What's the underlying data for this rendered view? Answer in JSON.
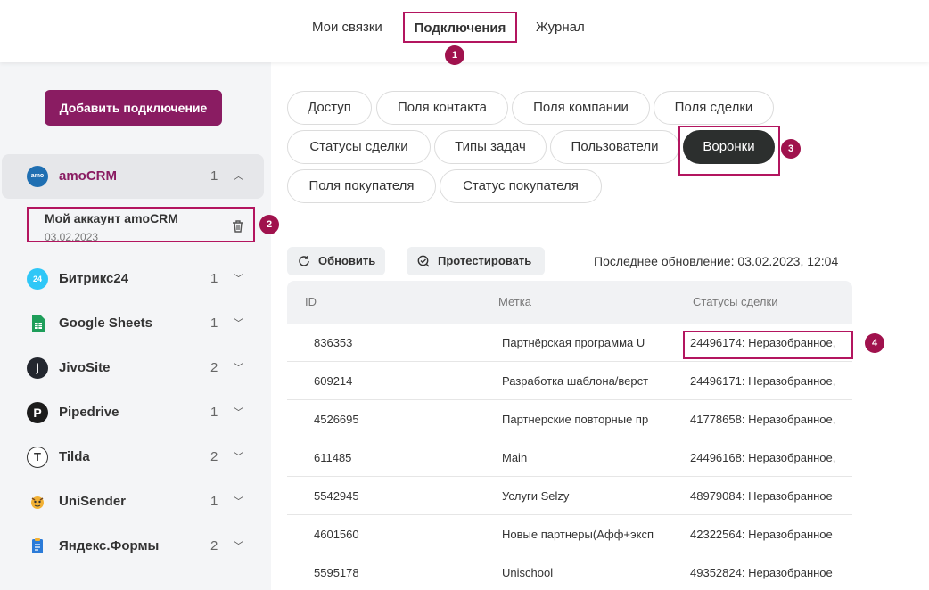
{
  "nav": {
    "tabs": [
      "Мои связки",
      "Подключения",
      "Журнал"
    ],
    "active": "Подключения"
  },
  "badges": [
    "1",
    "2",
    "3",
    "4"
  ],
  "sidebar": {
    "add_button": "Добавить подключение",
    "services": [
      {
        "name": "amoCRM",
        "count": "1",
        "logo": "amo",
        "color": "#1f6fb2",
        "icon": "amocrm-logo-icon"
      },
      {
        "name": "Битрикс24",
        "count": "1",
        "logo": "24",
        "color": "#2fc7f7",
        "icon": "bitrix24-logo-icon"
      },
      {
        "name": "Google Sheets",
        "count": "1",
        "logo": "",
        "color": "#1e9e5a",
        "icon": "google-sheets-logo-icon"
      },
      {
        "name": "JivoSite",
        "count": "2",
        "logo": "j",
        "color": "#23272f",
        "icon": "jivosite-logo-icon"
      },
      {
        "name": "Pipedrive",
        "count": "1",
        "logo": "P",
        "color": "#1c1c1c",
        "icon": "pipedrive-logo-icon"
      },
      {
        "name": "Tilda",
        "count": "2",
        "logo": "T",
        "color": "#ffffff",
        "icon": "tilda-logo-icon"
      },
      {
        "name": "UniSender",
        "count": "1",
        "logo": "",
        "color": "#f2b134",
        "icon": "unisender-logo-icon"
      },
      {
        "name": "Яндекс.Формы",
        "count": "2",
        "logo": "",
        "color": "#2b7bd8",
        "icon": "yandex-forms-logo-icon"
      }
    ],
    "account": {
      "name": "Мой аккаунт amoCRM",
      "date": "03.02.2023"
    }
  },
  "chips": [
    "Доступ",
    "Поля контакта",
    "Поля компании",
    "Поля сделки",
    "Статусы сделки",
    "Типы задач",
    "Пользователи",
    "Воронки",
    "Поля покупателя",
    "Статус покупателя"
  ],
  "active_chip": "Воронки",
  "toolbar": {
    "refresh": "Обновить",
    "test": "Протестировать",
    "last_update": "Последнее обновление: 03.02.2023, 12:04"
  },
  "table": {
    "headers": [
      "ID",
      "Метка",
      "Статусы сделки"
    ],
    "rows": [
      [
        "836353",
        "Партнёрская программа U",
        "24496174: Неразобранное,"
      ],
      [
        "609214",
        "Разработка шаблона/верст",
        "24496171: Неразобранное,"
      ],
      [
        "4526695",
        "Партнерские повторные пр",
        "41778658: Неразобранное,"
      ],
      [
        "611485",
        "Main",
        "24496168: Неразобранное,"
      ],
      [
        "5542945",
        "Услуги Selzy",
        "48979084: Неразобранное"
      ],
      [
        "4601560",
        "Новые партнеры(Афф+эксп",
        "42322564: Неразобранное"
      ],
      [
        "5595178",
        "Unischool",
        "49352824: Неразобранное"
      ]
    ]
  }
}
